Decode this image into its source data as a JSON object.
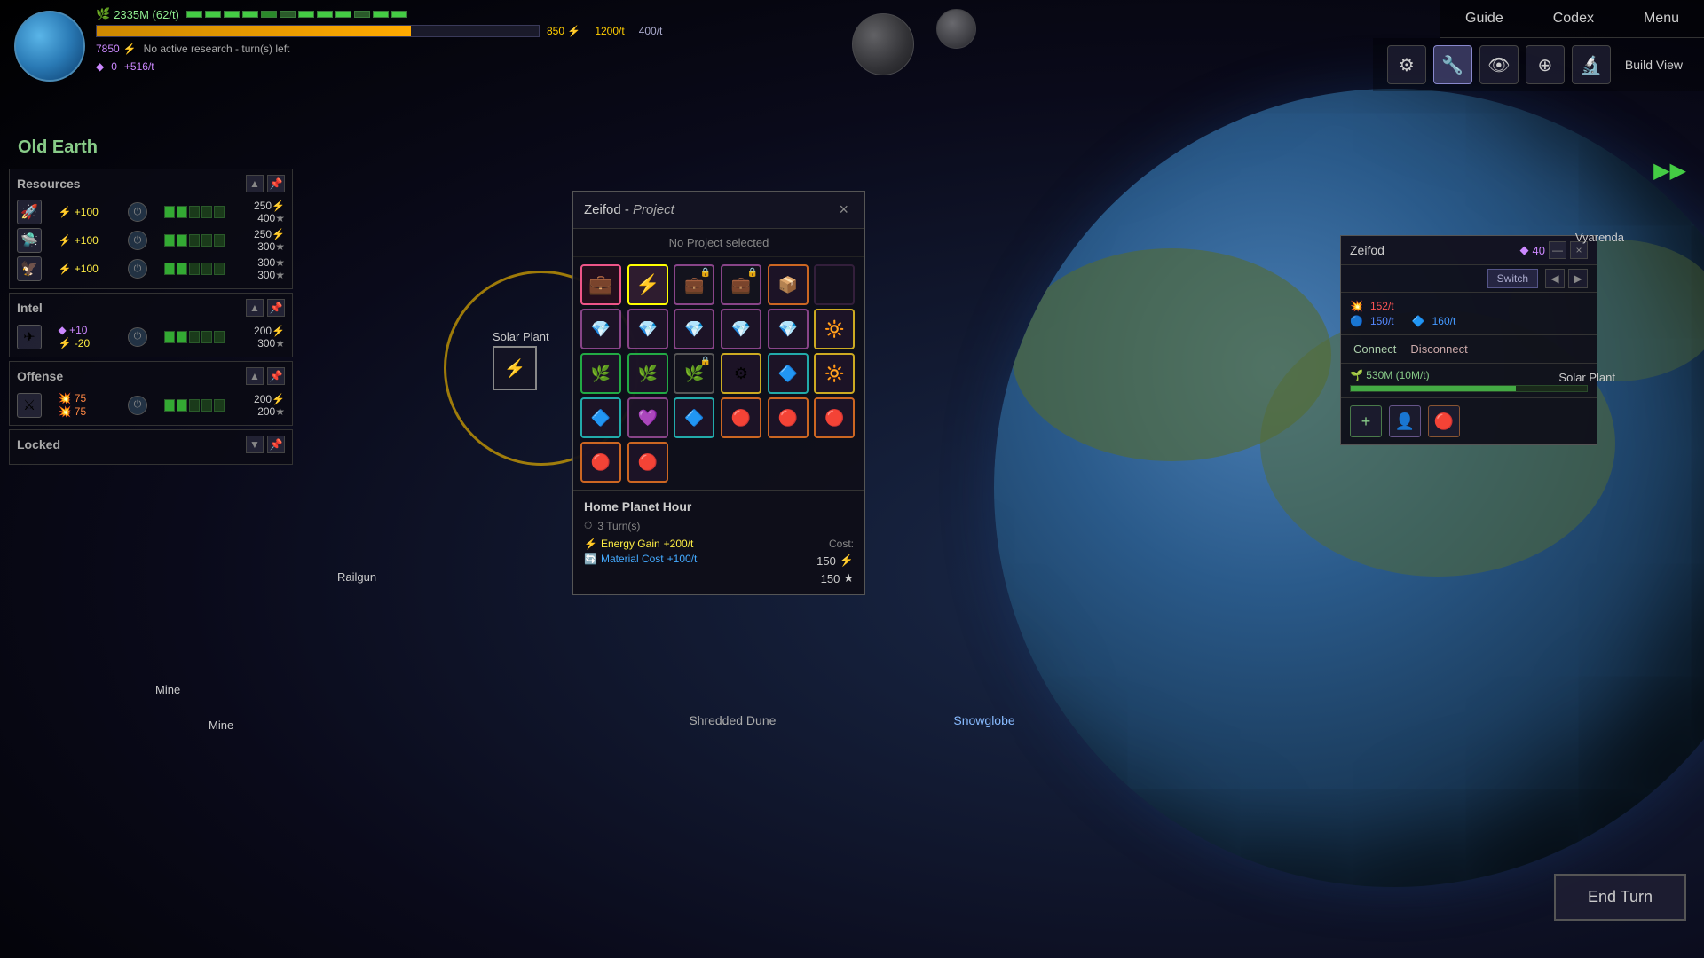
{
  "header": {
    "planet_icon_label": "Planet",
    "resources_label": "2335M (62/t)",
    "energy_star_label": "★",
    "progress_val": "850",
    "progress_unit": "★",
    "progress_right1": "1200/t",
    "progress_right2": "400/t",
    "research_val": "7850",
    "research_unit": "★",
    "research_label": "No active research  -  turn(s) left",
    "purple_val": "0",
    "purple_rate": "+516/t"
  },
  "nav": {
    "guide": "Guide",
    "codex": "Codex",
    "menu": "Menu",
    "build_view": "Build View"
  },
  "planet_name": "Old Earth",
  "left_panels": {
    "resources": {
      "title": "Resources",
      "rows": [
        {
          "icon": "🚀",
          "bonus": "+100",
          "value": "250",
          "rate": "400"
        },
        {
          "icon": "🛸",
          "bonus": "+100",
          "value": "250",
          "rate": "300"
        },
        {
          "icon": "⚡",
          "bonus": "+100",
          "value": "300",
          "rate": "300"
        }
      ]
    },
    "intel": {
      "title": "Intel",
      "rows": [
        {
          "icon": "✈",
          "bonus_purple": "+10",
          "bonus_energy": "-20",
          "value": "200",
          "rate": "300"
        }
      ]
    },
    "offense": {
      "title": "Offense",
      "rows": [
        {
          "icon": "⚔",
          "bonus": "75",
          "value": "200",
          "rate": "200"
        }
      ]
    },
    "locked": {
      "title": "Locked"
    }
  },
  "project_panel": {
    "title": "Zeifod",
    "title_sub": "Project",
    "close": "×",
    "no_project": "No Project selected",
    "items": [
      {
        "type": "pink",
        "selected": false
      },
      {
        "type": "blue",
        "selected": true
      },
      {
        "type": "purple-locked",
        "selected": false
      },
      {
        "type": "gold-locked",
        "selected": false
      },
      {
        "type": "orange",
        "selected": false
      },
      {
        "type": "empty",
        "selected": false
      },
      {
        "type": "purple",
        "selected": false
      },
      {
        "type": "purple",
        "selected": false
      },
      {
        "type": "purple",
        "selected": false
      },
      {
        "type": "purple",
        "selected": false
      },
      {
        "type": "purple",
        "selected": false
      },
      {
        "type": "gold",
        "selected": false
      },
      {
        "type": "green",
        "selected": false
      },
      {
        "type": "green",
        "selected": false
      },
      {
        "type": "teal-locked",
        "selected": false
      },
      {
        "type": "gold",
        "selected": false
      },
      {
        "type": "teal",
        "selected": false
      },
      {
        "type": "gold2",
        "selected": false
      },
      {
        "type": "teal",
        "selected": false
      },
      {
        "type": "purple",
        "selected": false
      },
      {
        "type": "teal",
        "selected": false
      },
      {
        "type": "orange",
        "selected": false
      },
      {
        "type": "orange",
        "selected": false
      },
      {
        "type": "orange",
        "selected": false
      },
      {
        "type": "orange",
        "selected": false
      },
      {
        "type": "orange",
        "selected": false
      },
      {
        "type": "orange",
        "selected": false
      },
      {
        "type": "orange",
        "selected": false
      },
      {
        "type": "orange2",
        "selected": false
      },
      {
        "type": "empty",
        "selected": false
      }
    ],
    "info": {
      "title": "Home Planet Hour",
      "turns": "3 Turn(s)",
      "energy_gain_label": "Energy Gain",
      "energy_gain_val": "+200/t",
      "material_cost_label": "Material Cost",
      "material_cost_val": "+100/t",
      "cost_label": "Cost:",
      "cost_energy": "150",
      "cost_energy_unit": "⚡",
      "cost_material": "150",
      "cost_material_unit": "★"
    }
  },
  "zeifod_panel": {
    "title": "Zeifod",
    "number": "40",
    "switch_label": "Switch",
    "stat1": "152/t",
    "stat2": "150/t",
    "stat3": "160/t",
    "growth_label": "530M (10M/t)",
    "connect_label": "Connect",
    "disconnect_label": "Disconnect"
  },
  "map_labels": {
    "shredded_dune": "Shredded Dune",
    "snowglobe": "Snowglobe"
  },
  "locations": {
    "solar_plant": "Solar Plant",
    "railgun": "Railgun",
    "mine1": "Mine",
    "mine2": "Mine",
    "vyarenda": "Vyarenda",
    "solar_plant_right": "Solar Plant"
  },
  "end_turn": "End Turn",
  "forward_arrow": "▶▶"
}
